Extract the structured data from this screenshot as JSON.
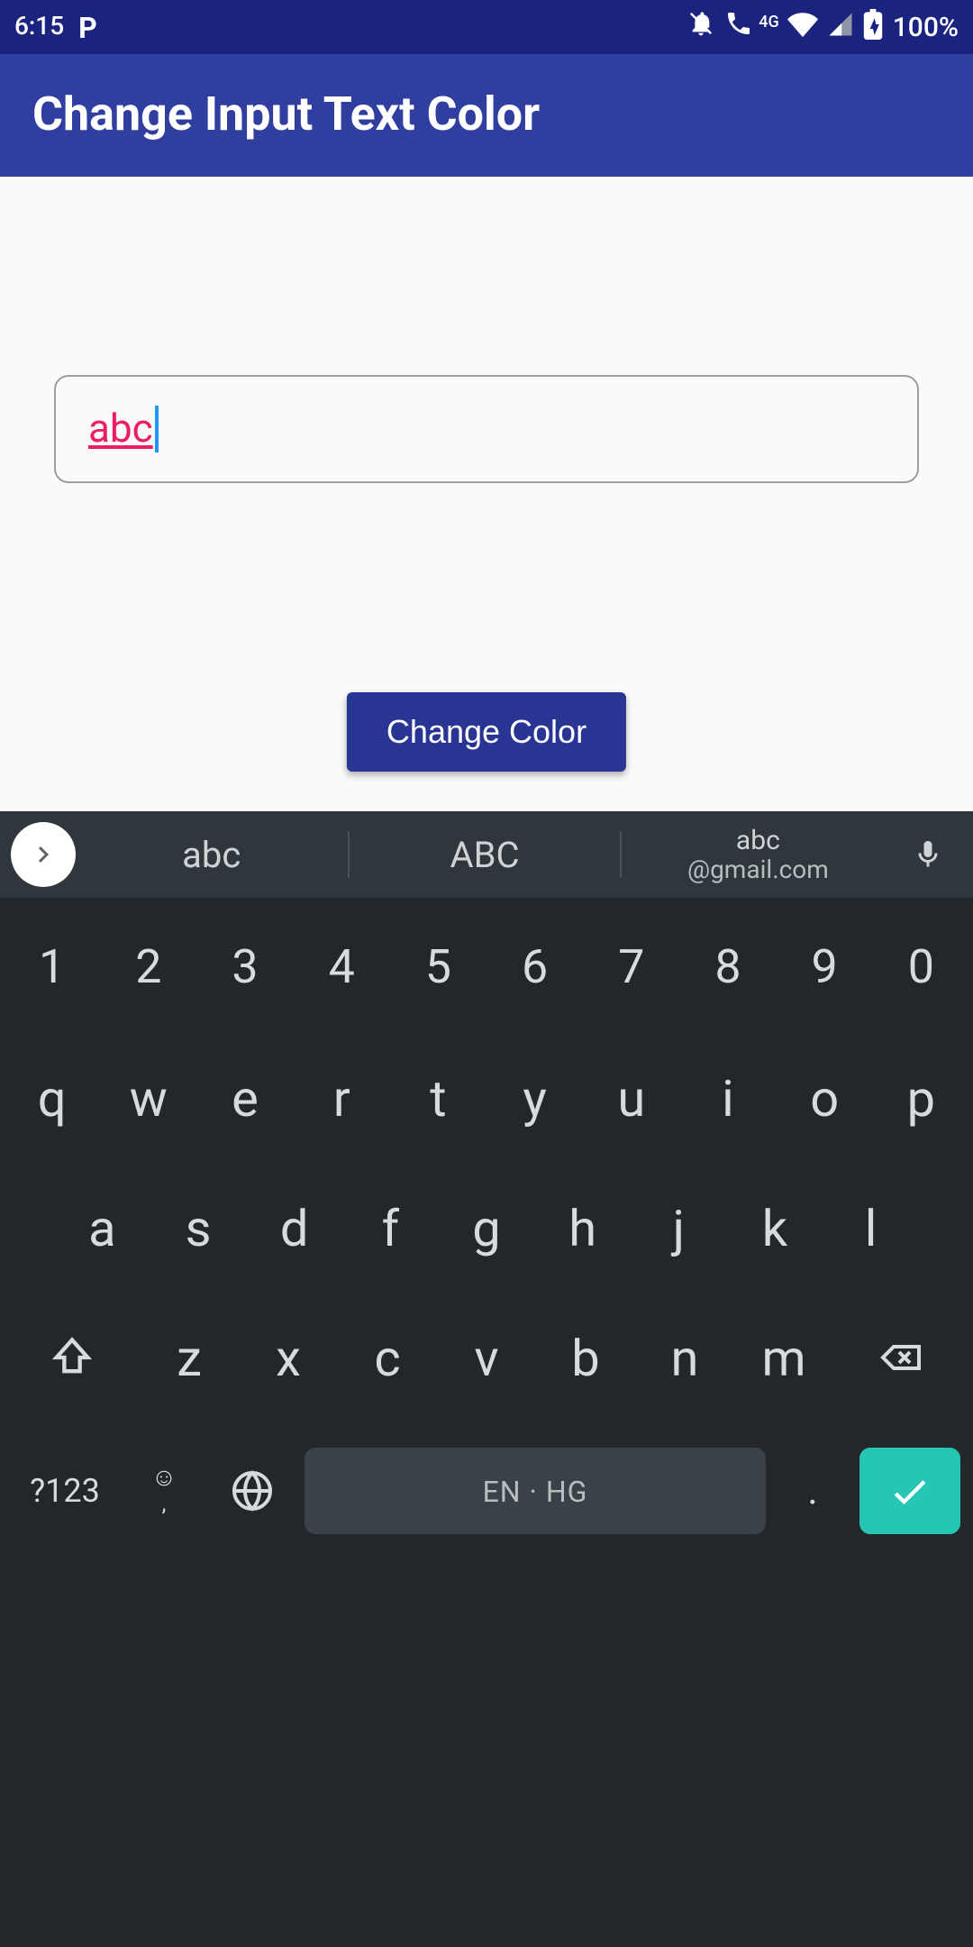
{
  "statusbar": {
    "time": "6:15",
    "battery": "100%"
  },
  "appbar": {
    "title": "Change Input Text Color"
  },
  "input": {
    "value": "abc",
    "text_color": "#e91e63"
  },
  "button": {
    "label": "Change Color"
  },
  "keyboard": {
    "suggestions": [
      "abc",
      "ABC"
    ],
    "suggestion3_top": "abc",
    "suggestion3_bottom": "@gmail.com",
    "row_num": [
      "1",
      "2",
      "3",
      "4",
      "5",
      "6",
      "7",
      "8",
      "9",
      "0"
    ],
    "row1": [
      "q",
      "w",
      "e",
      "r",
      "t",
      "y",
      "u",
      "i",
      "o",
      "p"
    ],
    "row2": [
      "a",
      "s",
      "d",
      "f",
      "g",
      "h",
      "j",
      "k",
      "l"
    ],
    "row3": [
      "z",
      "x",
      "c",
      "v",
      "b",
      "n",
      "m"
    ],
    "sym_label": "?123",
    "comma_label": ",",
    "space_label": "EN · HG",
    "period_label": "."
  }
}
